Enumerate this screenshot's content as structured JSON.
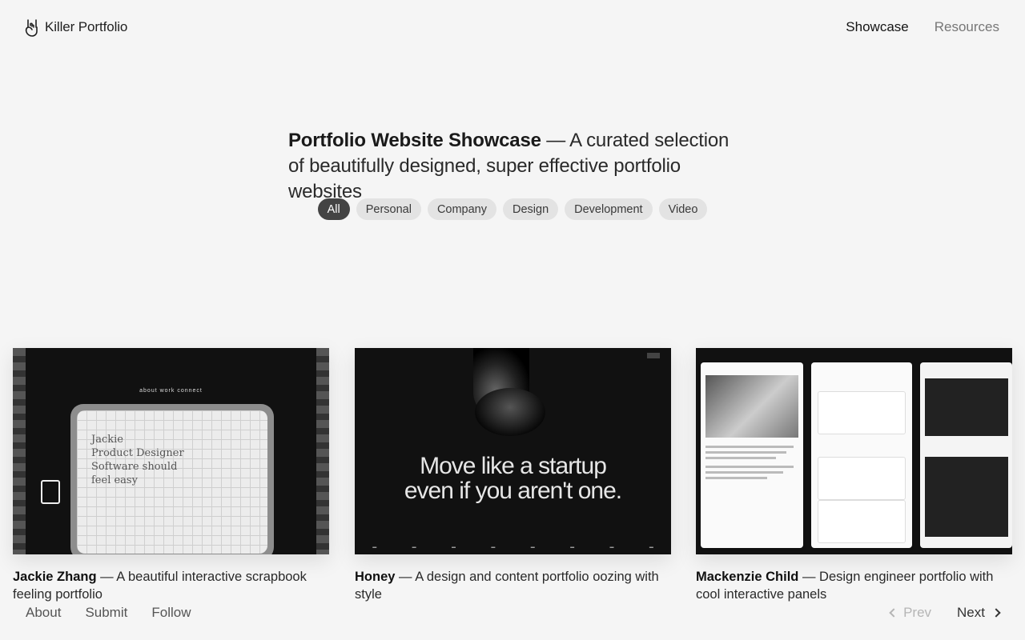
{
  "header": {
    "brand_label": "Killer Portfolio",
    "brand_icon": "rock-hand-icon",
    "nav": [
      {
        "label": "Showcase",
        "active": true
      },
      {
        "label": "Resources",
        "active": false
      }
    ]
  },
  "hero": {
    "title_bold": "Portfolio Website Showcase",
    "title_rest": " — A curated selection of beautifully designed, super effective portfolio websites"
  },
  "filters": [
    {
      "label": "All",
      "active": true
    },
    {
      "label": "Personal",
      "active": false
    },
    {
      "label": "Company",
      "active": false
    },
    {
      "label": "Design",
      "active": false
    },
    {
      "label": "Development",
      "active": false
    },
    {
      "label": "Video",
      "active": false
    }
  ],
  "cards": [
    {
      "name": "Jackie Zhang",
      "description": " — A beautiful interactive scrapbook feeling portfolio",
      "thumb_menu": "about     work     connect",
      "thumb_text": "Jackie\nProduct Designer\nSoftware should\nfeel easy"
    },
    {
      "name": "Honey",
      "description": " — A design and content portfolio oozing with style",
      "thumb_headline_1": "Move like a startup",
      "thumb_headline_2": "even if you aren't one."
    },
    {
      "name": "Mackenzie Child",
      "description": " — Design engineer portfolio with cool interactive panels"
    }
  ],
  "footer": {
    "links": [
      "About",
      "Submit",
      "Follow"
    ],
    "prev_label": "Prev",
    "next_label": "Next"
  },
  "colors": {
    "background": "#f5f5f5",
    "pill_active": "#444444",
    "pill_inactive": "#e3e3e3"
  }
}
